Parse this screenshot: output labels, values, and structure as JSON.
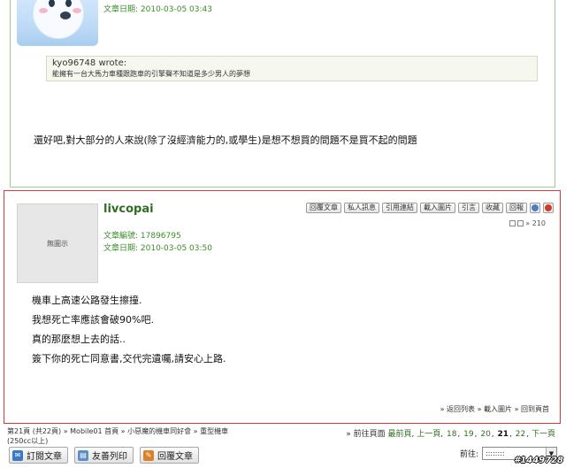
{
  "prev_post": {
    "date": "文章日期: 2010-03-05 03:43",
    "quote_author": "kyo96748 wrote:",
    "quote_text": "能擁有一台大馬力車種跟跑車的引擎聲不知道是多少男人的夢想",
    "body": "還好吧,對大部分的人來說(除了沒經濟能力的,或學生)是想不想買的問題不是買不起的問題"
  },
  "post": {
    "avatar_text": "無圖示",
    "username": "livcopai",
    "post_id": "文章編號: 17896795",
    "date": "文章日期: 2010-03-05 03:50",
    "toolbar": [
      "回覆文章",
      "私人訊息",
      "引用連結",
      "載入圖片",
      "引言",
      "收藏",
      "回報"
    ],
    "toolbar_icons": [
      {
        "name": "thumb-icon",
        "color": "#4a7fc1"
      },
      {
        "name": "alert-icon",
        "color": "#d23a2a"
      }
    ],
    "floor": "» 210",
    "body_lines": [
      "機車上高速公路發生擦撞.",
      "我想死亡率應該會破90%吧.",
      "真的那麼想上去的話..",
      "簽下你的死亡同意書,交代完遺囑,請安心上路."
    ],
    "footer": {
      "back": "» 返回列表",
      "load_images": "» 載入圖片",
      "top": "» 回到頁首"
    }
  },
  "breadcrumb": {
    "page": "第21頁 (共22頁)",
    "items": [
      "Mobile01 首頁",
      "小惡魔的機車同好會",
      "重型機車"
    ],
    "tail": "(250cc以上)"
  },
  "pager": {
    "prefix": "» 前往頁面",
    "first": "最前頁",
    "prev": "上一頁",
    "pages": [
      "18",
      "19",
      "20",
      "21",
      "22"
    ],
    "current": "21",
    "next": "下一頁"
  },
  "bottom_buttons": [
    {
      "label": "訂閱文章",
      "icon": "subscribe-icon",
      "color": "#3b78c8"
    },
    {
      "label": "友善列印",
      "icon": "print-icon",
      "color": "#5b8fc6"
    },
    {
      "label": "回覆文章",
      "icon": "reply-icon",
      "color": "#d9822b"
    }
  ],
  "goto": {
    "label": "前往:",
    "value": "::::::::"
  },
  "watermark": "#1449728"
}
